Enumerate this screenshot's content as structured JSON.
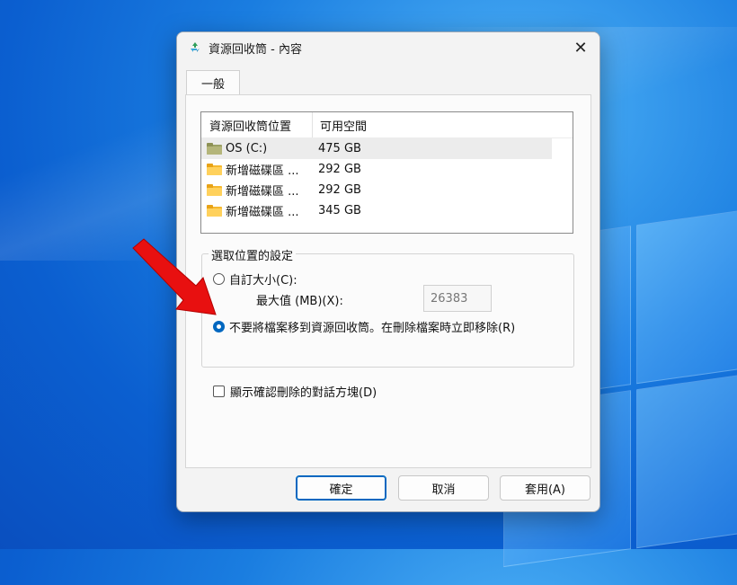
{
  "dialog": {
    "title": "資源回收筒 - 內容",
    "close_glyph": "✕",
    "tab": "一般"
  },
  "listview": {
    "col_location": "資源回收筒位置",
    "col_space": "可用空間",
    "rows": [
      {
        "name": "OS (C:)",
        "space": "475 GB",
        "icon": "drive-icon",
        "selected": true
      },
      {
        "name": "新增磁碟區 ...",
        "space": "292 GB",
        "icon": "folder-icon",
        "selected": false
      },
      {
        "name": "新增磁碟區 ...",
        "space": "292 GB",
        "icon": "folder-icon",
        "selected": false
      },
      {
        "name": "新增磁碟區 ...",
        "space": "345 GB",
        "icon": "folder-icon",
        "selected": false
      }
    ]
  },
  "settings": {
    "group_title": "選取位置的設定",
    "custom_size_label": "自訂大小(C):",
    "custom_size_selected": false,
    "max_size_label": "最大值 (MB)(X):",
    "max_size_value": "26383",
    "dont_move_label": "不要將檔案移到資源回收筒。在刪除檔案時立即移除(R)",
    "dont_move_selected": true,
    "confirm_delete_label": "顯示確認刪除的對話方塊(D)",
    "confirm_delete_checked": false
  },
  "buttons": {
    "ok": "確定",
    "cancel": "取消",
    "apply": "套用(A)"
  },
  "colors": {
    "accent": "#0067c0",
    "annotation_arrow": "#e81010"
  }
}
